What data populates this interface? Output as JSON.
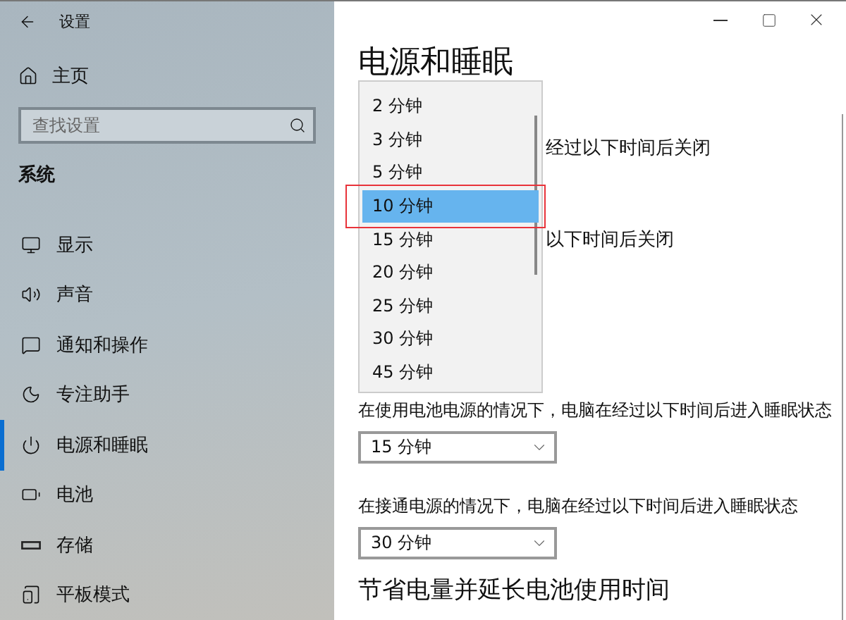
{
  "window": {
    "title": "设置"
  },
  "sidebar": {
    "home": "主页",
    "search": {
      "placeholder": "查找设置"
    },
    "section": "系统",
    "items": [
      {
        "label": "显示",
        "kind": "monitor",
        "selected": false
      },
      {
        "label": "声音",
        "kind": "speaker",
        "selected": false
      },
      {
        "label": "通知和操作",
        "kind": "message",
        "selected": false
      },
      {
        "label": "专注助手",
        "kind": "moon",
        "selected": false
      },
      {
        "label": "电源和睡眠",
        "kind": "power",
        "selected": true
      },
      {
        "label": "电池",
        "kind": "battery",
        "selected": false
      },
      {
        "label": "存储",
        "kind": "drive",
        "selected": false
      },
      {
        "label": "平板模式",
        "kind": "tablet",
        "selected": false
      }
    ]
  },
  "main": {
    "title": "电源和睡眠",
    "partial_labels": [
      "经过以下时间后关闭",
      "以下时间后关闭"
    ],
    "dropdown_list": [
      {
        "label": "2 分钟",
        "selected": false,
        "highlighted": false
      },
      {
        "label": "3 分钟",
        "selected": false,
        "highlighted": false
      },
      {
        "label": "5 分钟",
        "selected": false,
        "highlighted": false
      },
      {
        "label": "10 分钟",
        "selected": true,
        "highlighted": true
      },
      {
        "label": "15 分钟",
        "selected": false,
        "highlighted": false
      },
      {
        "label": "20 分钟",
        "selected": false,
        "highlighted": false
      },
      {
        "label": "25 分钟",
        "selected": false,
        "highlighted": false
      },
      {
        "label": "30 分钟",
        "selected": false,
        "highlighted": false
      },
      {
        "label": "45 分钟",
        "selected": false,
        "highlighted": false
      }
    ],
    "sleep_settings": [
      {
        "label": "在使用电池电源的情况下，电脑在经过以下时间后进入睡眠状态",
        "value": "15 分钟"
      },
      {
        "label": "在接通电源的情况下，电脑在经过以下时间后进入睡眠状态",
        "value": "30 分钟"
      }
    ],
    "next_heading": "节省电量并延长电池使用时间"
  }
}
